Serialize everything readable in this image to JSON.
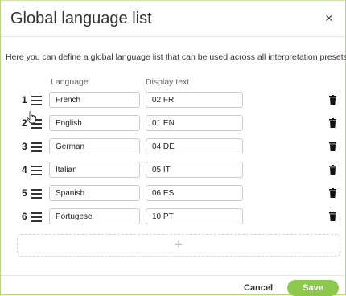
{
  "dialog": {
    "title": "Global language list",
    "close_label": "×",
    "description": "Here you can define a global language list that can be used across all interpretation presets."
  },
  "columns": {
    "language": "Language",
    "display_text": "Display text"
  },
  "rows": [
    {
      "number": "1",
      "language": "French",
      "display_text": "02 FR"
    },
    {
      "number": "2",
      "language": "English",
      "display_text": "01 EN"
    },
    {
      "number": "3",
      "language": "German",
      "display_text": "04 DE"
    },
    {
      "number": "4",
      "language": "Italian",
      "display_text": "05 IT"
    },
    {
      "number": "5",
      "language": "Spanish",
      "display_text": "06 ES"
    },
    {
      "number": "6",
      "language": "Portugese",
      "display_text": "10 PT"
    }
  ],
  "add_row": {
    "label": "+"
  },
  "footer": {
    "cancel_label": "Cancel",
    "save_label": "Save"
  },
  "colors": {
    "save_button": "#8cc84b",
    "dialog_border": "#b9d87a"
  },
  "icons": {
    "drag_handle": "drag-handle-icon",
    "delete": "trash-icon",
    "close": "close-icon",
    "cursor": "hand-cursor-icon"
  }
}
